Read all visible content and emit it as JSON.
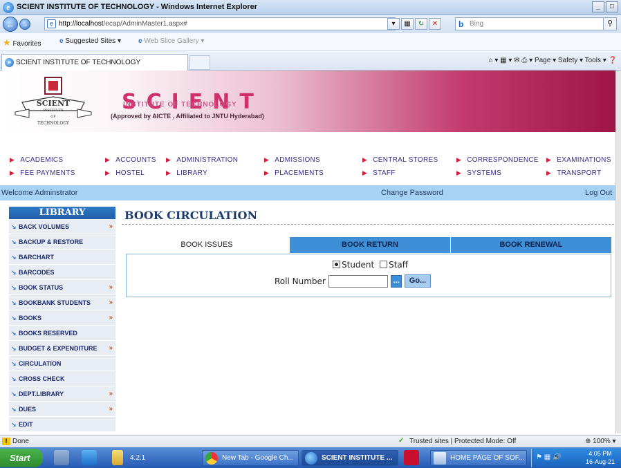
{
  "window": {
    "title": "SCIENT INSTITUTE OF TECHNOLOGY - Windows Internet Explorer",
    "controls": [
      "_",
      "□",
      "×"
    ]
  },
  "addressbar": {
    "url_host": "http://localhost",
    "url_path": "/ecap/AdminMaster1.aspx#",
    "search_placeholder": "Bing"
  },
  "favorites": {
    "favorites_label": "Favorites",
    "suggested_label": "Suggested Sites ▾",
    "gallery_label": "Web Slice Gallery ▾"
  },
  "tab": {
    "label": "SCIENT INSTITUTE OF TECHNOLOGY",
    "commands": "Page ▾   Safety ▾   Tools ▾"
  },
  "banner": {
    "brand": "SCIENT",
    "institute": "INSTITUTE OF TECHNOLOGY",
    "approval": "(Approved by AICTE , Affiliated to JNTU Hyderabad)",
    "logo_text_top": "SCIENT",
    "logo_text_mid": "INSTITUTE",
    "logo_text_of": "OF",
    "logo_text_bottom": "TECHNOLOGY"
  },
  "menu": {
    "row1": [
      "ACADEMICS",
      "ACCOUNTS",
      "ADMINISTRATION",
      "ADMISSIONS",
      "CENTRAL STORES",
      "CORRESPONDENCE",
      "EXAMINATIONS"
    ],
    "row2": [
      "FEE PAYMENTS",
      "HOSTEL",
      "LIBRARY",
      "PLACEMENTS",
      "STAFF",
      "SYSTEMS",
      "TRANSPORT"
    ]
  },
  "welcome": {
    "greeting": "Welcome Adminstrator",
    "change_password": "Change Password",
    "logout": "Log Out"
  },
  "sidebar": {
    "heading": "LIBRARY",
    "items": [
      {
        "label": "BACK VOLUMES",
        "more": "»"
      },
      {
        "label": "BACKUP & RESTORE",
        "more": ""
      },
      {
        "label": "BARCHART",
        "more": ""
      },
      {
        "label": "BARCODES",
        "more": ""
      },
      {
        "label": "BOOK STATUS",
        "more": "»"
      },
      {
        "label": "BOOKBANK STUDENTS",
        "more": "»"
      },
      {
        "label": "BOOKS",
        "more": "»"
      },
      {
        "label": "BOOKS RESERVED",
        "more": ""
      },
      {
        "label": "BUDGET & EXPENDITURE",
        "more": "»"
      },
      {
        "label": "CIRCULATION",
        "more": ""
      },
      {
        "label": "CROSS CHECK",
        "more": ""
      },
      {
        "label": "DEPT.LIBRARY",
        "more": "»"
      },
      {
        "label": "DUES",
        "more": "»"
      },
      {
        "label": "EDIT",
        "more": ""
      }
    ]
  },
  "main": {
    "title": "BOOK CIRCULATION",
    "tabs": [
      "BOOK ISSUES",
      "BOOK RETURN",
      "BOOK RENEWAL"
    ],
    "radio_student": "Student",
    "radio_staff": "Staff",
    "roll_label": "Roll Number :",
    "roll_value": "",
    "dots_button": "...",
    "go_button": "Go..."
  },
  "status": {
    "done": "Done",
    "zone": "Trusted sites | Protected Mode: Off",
    "zoom": "⊕ 100%  ▾"
  },
  "taskbar": {
    "start": "Start",
    "folder_label": "4.2.1",
    "chrome_label": "New Tab - Google Ch...",
    "ie_label": "SCIENT INSTITUTE ...",
    "word_label": "HOME PAGE OF SOF...",
    "time": "4:05 PM",
    "date": "16-Aug-21"
  },
  "colors": {
    "banner_accent": "#c23b6f",
    "welcome_bar": "#a8d2f4",
    "tab_inactive": "#3e8fd6",
    "sidebar_head": "#1f5ea8"
  }
}
